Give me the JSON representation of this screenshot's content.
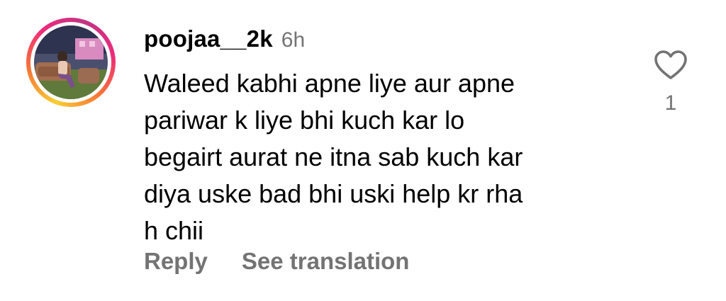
{
  "comment": {
    "username": "poojaa__2k",
    "timestamp": "6h",
    "text_lines": [
      "Waleed kabhi apne liye aur apne",
      "pariwar k liye bhi kuch kar lo",
      "begairt aurat ne itna sab kuch kar",
      "diya uske bad bhi uski help kr rha",
      "h chii"
    ],
    "like_count": "1",
    "like_icon": "heart-outline-icon",
    "actions": {
      "reply_label": "Reply",
      "translate_label": "See translation"
    }
  },
  "colors": {
    "text": "#000000",
    "secondary_text": "#737373",
    "story_ring": [
      "#f9ce34",
      "#ee2a7b",
      "#c13584"
    ]
  }
}
